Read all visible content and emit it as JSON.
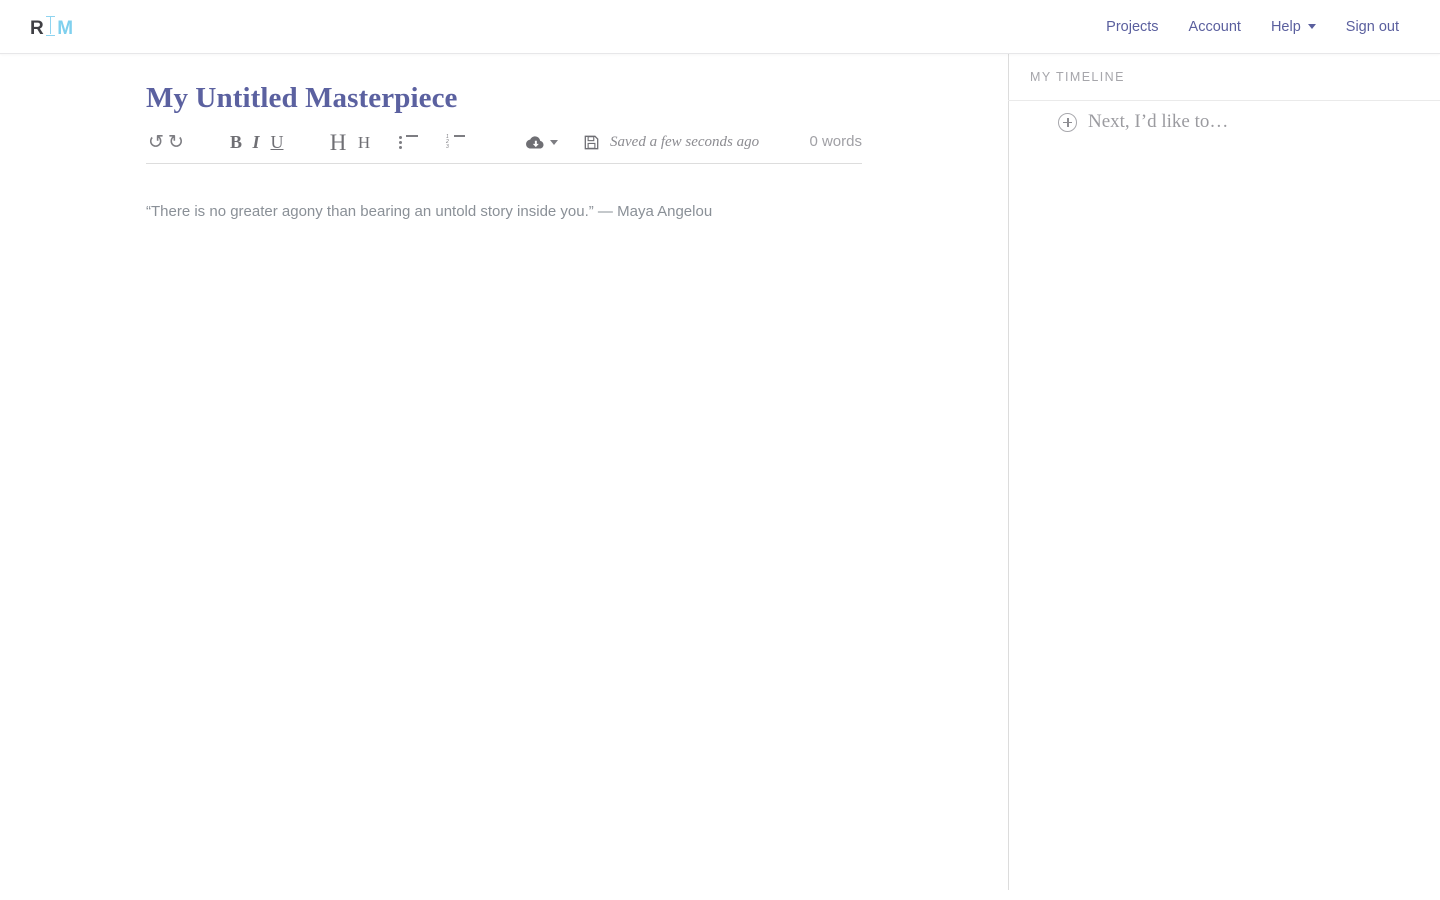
{
  "brand": {
    "mark_left": "R",
    "mark_right": "M",
    "cursor_icon": "text-cursor-icon"
  },
  "nav": {
    "items": [
      {
        "label": "Projects",
        "has_caret": false
      },
      {
        "label": "Account",
        "has_caret": false
      },
      {
        "label": "Help",
        "has_caret": true
      },
      {
        "label": "Sign out",
        "has_caret": false
      }
    ]
  },
  "editor": {
    "title": "My Untitled Masterpiece",
    "body_text": "“There is no greater agony than bearing an untold story inside you.” — Maya Angelou",
    "toolbar": {
      "undo": "↺",
      "redo": "↻",
      "bold": "B",
      "italic": "I",
      "underline": "U",
      "heading1": "H",
      "heading2": "H",
      "bullet_list_icon": "unordered-list-icon",
      "numbered_list_icon": "ordered-list-icon",
      "numbered_list_markers": [
        "1",
        "2",
        "3"
      ],
      "export_icon": "cloud-download-icon",
      "save_icon": "floppy-save-icon",
      "saved_status": "Saved a few seconds ago",
      "word_count": "0 words"
    }
  },
  "sidebar": {
    "title": "My Timeline",
    "add_item": {
      "icon": "plus-circle-icon",
      "label": "Next, I’d like to…"
    }
  },
  "colors": {
    "brand_accent": "#7fd0ee",
    "nav_link": "#5a5f9e",
    "doc_title": "#5b61a0",
    "body_text": "#8a9097",
    "muted": "#a6a6ab",
    "border": "#dcdcdc"
  }
}
